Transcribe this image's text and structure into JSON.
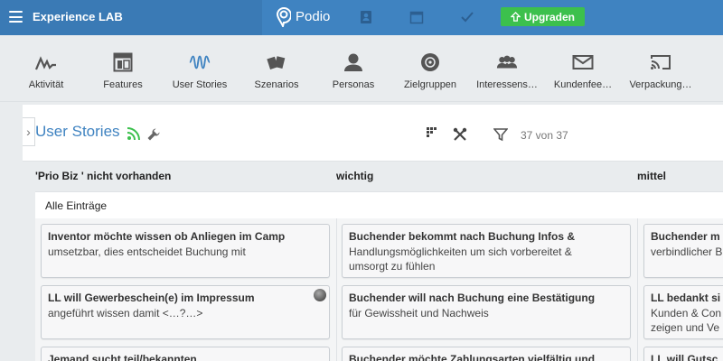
{
  "topbar": {
    "workspace": "Experience LAB",
    "brand": "Podio",
    "upgrade_label": "Upgraden",
    "icons": [
      "contacts-icon",
      "calendar-icon",
      "tasks-icon"
    ],
    "colors": {
      "bar": "#3f83c1",
      "upgrade": "#3cc04d"
    }
  },
  "apps": [
    {
      "label": "Aktivität",
      "icon": "activity-icon"
    },
    {
      "label": "Features",
      "icon": "layout-icon"
    },
    {
      "label": "User Stories",
      "icon": "wave-icon"
    },
    {
      "label": "Szenarios",
      "icon": "cards-icon"
    },
    {
      "label": "Personas",
      "icon": "person-icon"
    },
    {
      "label": "Zielgruppen",
      "icon": "target-icon"
    },
    {
      "label": "Interessens…",
      "icon": "group-icon"
    },
    {
      "label": "Kundenfee…",
      "icon": "mail-icon"
    },
    {
      "label": "Verpackung…",
      "icon": "cast-icon"
    }
  ],
  "main": {
    "title": "User Stories",
    "count": "37 von 37"
  },
  "board": {
    "columns": [
      "'Prio Biz ' nicht vorhanden",
      "wichtig",
      "mittel"
    ],
    "section": "Alle Einträge",
    "cards": [
      [
        {
          "title": "Inventor möchte wissen ob Anliegen im Camp",
          "lines": [
            "umsetzbar, dies entscheidet Buchung mit"
          ]
        },
        {
          "title": "LL will Gewerbeschein(e) im Impressum",
          "lines": [
            "angeführt wissen damit <…?…>"
          ]
        },
        {
          "title": "Jemand sucht teil/bekannten",
          "lines": []
        }
      ],
      [
        {
          "title": "Buchender bekommt nach Buchung Infos &",
          "lines": [
            "Handlungsmöglichkeiten um sich vorbereitet &",
            "umsorgt zu fühlen"
          ]
        },
        {
          "title": "Buchender will nach Buchung eine Bestätigung",
          "lines": [
            "für Gewissheit und Nachweis"
          ]
        },
        {
          "title": "Buchender möchte Zahlungsarten vielfältig und",
          "lines": []
        }
      ],
      [
        {
          "title": "Buchender m",
          "lines": [
            "verbindlicher B"
          ]
        },
        {
          "title": "LL bedankt si",
          "lines": [
            "Kunden & Con",
            "zeigen und Ve"
          ]
        },
        {
          "title": "LL will Gutsc",
          "lines": []
        }
      ]
    ]
  }
}
